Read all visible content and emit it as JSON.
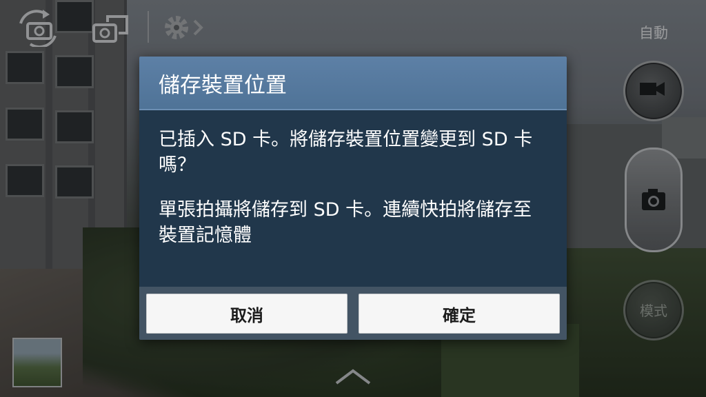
{
  "camera": {
    "auto_label": "自動",
    "mode_label": "模式",
    "icons": {
      "switch_camera": "switch-camera-icon",
      "self_mode": "self-camera-icon",
      "settings": "gear-icon",
      "record": "video-camera-icon",
      "shutter": "camera-icon",
      "expand": "chevron-up-icon"
    }
  },
  "dialog": {
    "title": "儲存裝置位置",
    "message1": "已插入 SD 卡。將儲存裝置位置變更到 SD 卡嗎？",
    "message2": "單張拍攝將儲存到 SD 卡。連續快拍將儲存至裝置記憶體",
    "cancel_label": "取消",
    "ok_label": "確定"
  },
  "colors": {
    "dialog_title_bg": "#5d80a6",
    "dialog_body_bg": "#21374b",
    "button_bg": "#f6f6f6"
  }
}
